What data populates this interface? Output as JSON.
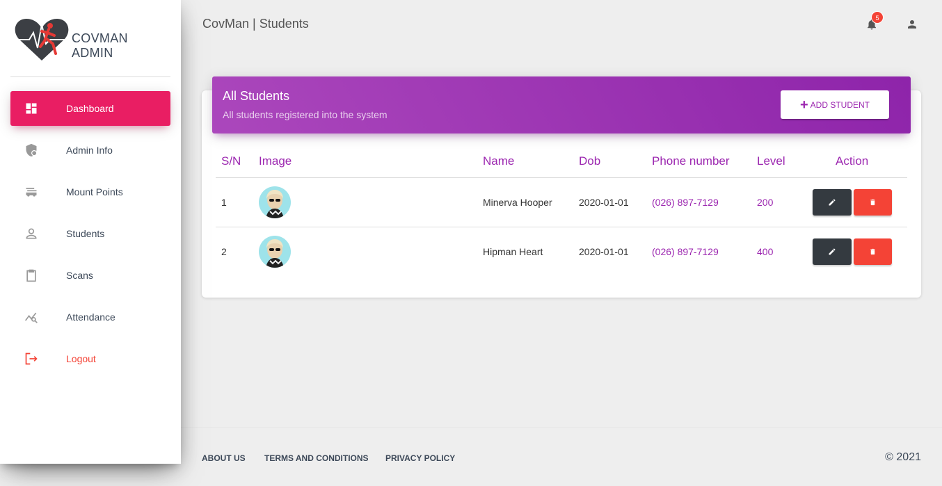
{
  "sidebar": {
    "brand": "COVMAN ADMIN",
    "items": [
      {
        "label": "Dashboard",
        "icon": "dashboard-icon"
      },
      {
        "label": "Admin Info",
        "icon": "admin-shield-icon"
      },
      {
        "label": "Mount Points",
        "icon": "mount-points-icon"
      },
      {
        "label": "Students",
        "icon": "person-icon"
      },
      {
        "label": "Scans",
        "icon": "clipboard-icon"
      },
      {
        "label": "Attendance",
        "icon": "attendance-chart-icon"
      },
      {
        "label": "Logout",
        "icon": "logout-icon"
      }
    ]
  },
  "topbar": {
    "title": "CovMan | Students",
    "notification_count": "5"
  },
  "card": {
    "title": "All Students",
    "subtitle": "All students registered into the system",
    "add_button": "ADD STUDENT"
  },
  "table": {
    "headers": [
      "S/N",
      "Image",
      "Name",
      "Dob",
      "Phone number",
      "Level",
      "Action"
    ],
    "rows": [
      {
        "sn": "1",
        "name": "Minerva Hooper",
        "dob": "2020-01-01",
        "phone": "(026) 897-7129",
        "level": "200"
      },
      {
        "sn": "2",
        "name": "Hipman Heart",
        "dob": "2020-01-01",
        "phone": "(026) 897-7129",
        "level": "400"
      }
    ]
  },
  "footer": {
    "links": [
      "ABOUT US",
      "TERMS AND CONDITIONS",
      "PRIVACY POLICY"
    ],
    "copyright": "© 2021"
  },
  "colors": {
    "active_nav": "#e91e63",
    "header_purple": "#9c27b0",
    "delete_red": "#f44336",
    "edit_dark": "#343a40"
  }
}
